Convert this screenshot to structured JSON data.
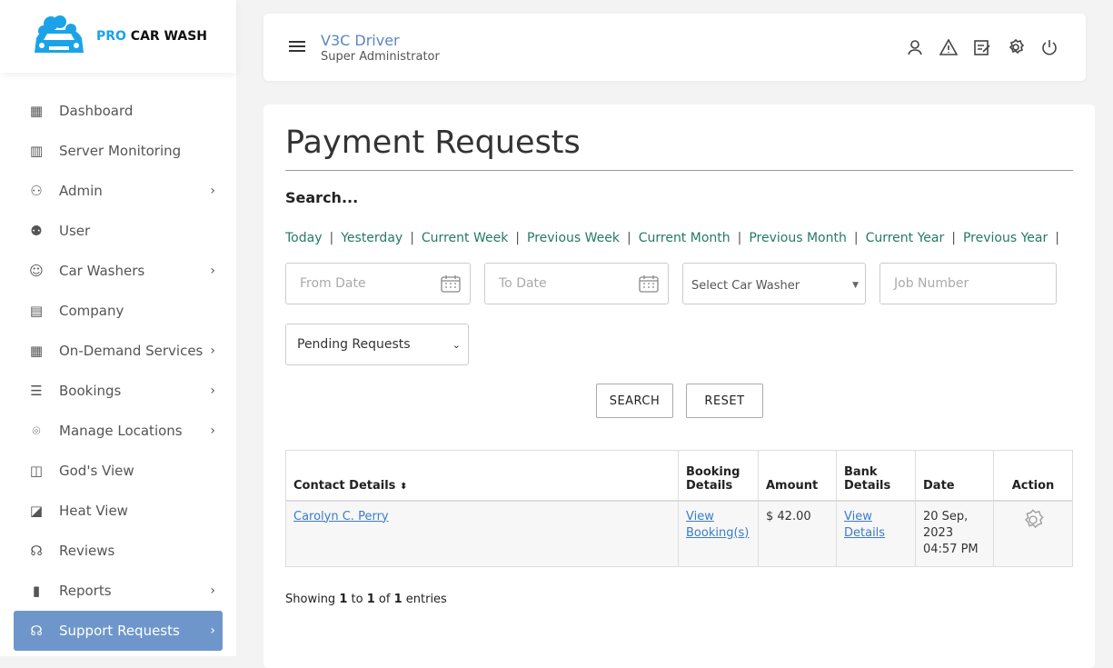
{
  "brand": {
    "pro": "PRO",
    "rest": "CAR WASH",
    "color": "#1ba3e8"
  },
  "sidebar": {
    "items": [
      {
        "label": "Dashboard",
        "icon": "dashboard-icon",
        "chevron": false
      },
      {
        "label": "Server Monitoring",
        "icon": "chart-icon",
        "chevron": false
      },
      {
        "label": "Admin",
        "icon": "user-lock-icon",
        "chevron": true
      },
      {
        "label": "User",
        "icon": "users-icon",
        "chevron": false
      },
      {
        "label": "Car Washers",
        "icon": "user-icon",
        "chevron": true
      },
      {
        "label": "Company",
        "icon": "building-icon",
        "chevron": false
      },
      {
        "label": "On-Demand Services",
        "icon": "grid-icon",
        "chevron": true
      },
      {
        "label": "Bookings",
        "icon": "list-icon",
        "chevron": true
      },
      {
        "label": "Manage Locations",
        "icon": "location-pin-icon",
        "chevron": true
      },
      {
        "label": "God's View",
        "icon": "map-icon",
        "chevron": false
      },
      {
        "label": "Heat View",
        "icon": "heat-map-icon",
        "chevron": false
      },
      {
        "label": "Reviews",
        "icon": "reviews-icon",
        "chevron": false
      },
      {
        "label": "Reports",
        "icon": "bar-chart-icon",
        "chevron": true
      },
      {
        "label": "Support Requests",
        "icon": "headset-icon",
        "chevron": true,
        "active": true
      }
    ]
  },
  "header": {
    "title": "V3C Driver",
    "subtitle": "Super Administrator"
  },
  "main": {
    "title": "Payment Requests",
    "search_label": "Search...",
    "quick_filters": [
      "Today",
      "Yesterday",
      "Current Week",
      "Previous Week",
      "Current Month",
      "Previous Month",
      "Current Year",
      "Previous Year"
    ],
    "from_date_placeholder": "From Date",
    "to_date_placeholder": "To Date",
    "car_washer_select": "Select Car Washer",
    "job_number_placeholder": "Job Number",
    "status_select": "Pending Requests",
    "search_button": "SEARCH",
    "reset_button": "RESET",
    "table": {
      "headers": [
        "Contact Details",
        "Booking Details",
        "Amount",
        "Bank Details",
        "Date",
        "Action"
      ],
      "rows": [
        {
          "contact": "Carolyn C. Perry",
          "booking": "View Booking(s)",
          "amount": "$ 42.00",
          "bank": "View Details",
          "date": "20 Sep, 2023 04:57 PM"
        }
      ]
    },
    "info": {
      "prefix": "Showing",
      "from": "1",
      "to_word": "to",
      "to": "1",
      "of_word": "of",
      "total": "1",
      "suffix": "entries"
    }
  },
  "colors": {
    "link_green": "#237a66",
    "active_bg": "#6e96cb",
    "link_blue": "#3b7dc4"
  }
}
